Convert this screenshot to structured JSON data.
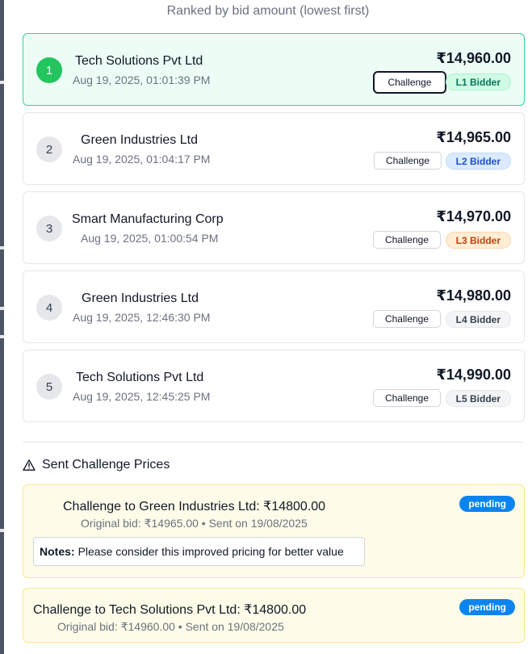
{
  "subtitle": "Ranked by bid amount (lowest first)",
  "bids": [
    {
      "rank": "1",
      "company": "Tech Solutions Pvt Ltd",
      "timestamp": "Aug 19, 2025, 01:01:39 PM",
      "amount": "₹14,960.00",
      "button": "Challenge",
      "badge": "L1 Bidder"
    },
    {
      "rank": "2",
      "company": "Green Industries Ltd",
      "timestamp": "Aug 19, 2025, 01:04:17 PM",
      "amount": "₹14,965.00",
      "button": "Challenge",
      "badge": "L2 Bidder"
    },
    {
      "rank": "3",
      "company": "Smart Manufacturing Corp",
      "timestamp": "Aug 19, 2025, 01:00:54 PM",
      "amount": "₹14,970.00",
      "button": "Challenge",
      "badge": "L3 Bidder"
    },
    {
      "rank": "4",
      "company": "Green Industries Ltd",
      "timestamp": "Aug 19, 2025, 12:46:30 PM",
      "amount": "₹14,980.00",
      "button": "Challenge",
      "badge": "L4 Bidder"
    },
    {
      "rank": "5",
      "company": "Tech Solutions Pvt Ltd",
      "timestamp": "Aug 19, 2025, 12:45:25 PM",
      "amount": "₹14,990.00",
      "button": "Challenge",
      "badge": "L5 Bidder"
    }
  ],
  "challenges_section": {
    "title": "Sent Challenge Prices",
    "icon": "warning-triangle-icon",
    "items": [
      {
        "title": "Challenge to Green Industries Ltd: ₹14800.00",
        "meta": "Original bid: ₹14965.00 • Sent on 19/08/2025",
        "status": "pending",
        "notes_label": "Notes:",
        "notes_text": "Please consider this improved pricing for better value"
      },
      {
        "title": "Challenge to Tech Solutions Pvt Ltd: ₹14800.00",
        "meta": "Original bid: ₹14960.00 • Sent on 19/08/2025",
        "status": "pending"
      }
    ]
  },
  "colors": {
    "l1_card_bg": "#ecfdf5",
    "l1_rank": "#22c55e",
    "pending_badge": "#0b84f0",
    "challenge_card_bg": "#fefce8"
  }
}
